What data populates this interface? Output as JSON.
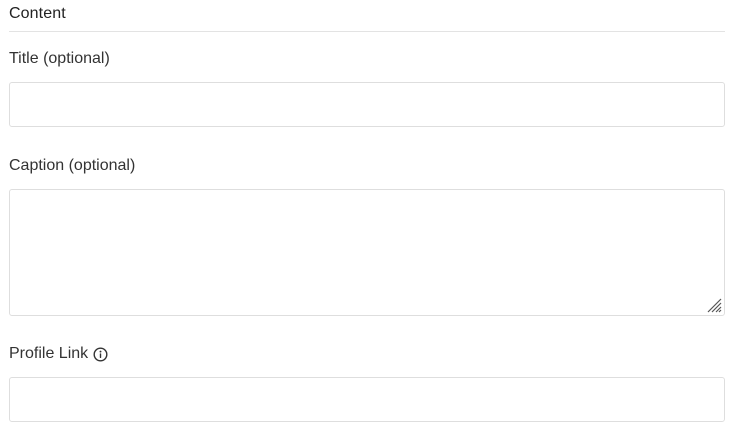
{
  "section": {
    "title": "Content"
  },
  "fields": {
    "title": {
      "label": "Title (optional)",
      "value": "",
      "placeholder": ""
    },
    "caption": {
      "label": "Caption (optional)",
      "value": "",
      "placeholder": ""
    },
    "profile_link": {
      "label": "Profile Link",
      "value": "",
      "placeholder": "",
      "icon": "info-icon"
    }
  },
  "colors": {
    "border": "#dedede",
    "divider": "#e3e3e3",
    "text": "#333333"
  }
}
